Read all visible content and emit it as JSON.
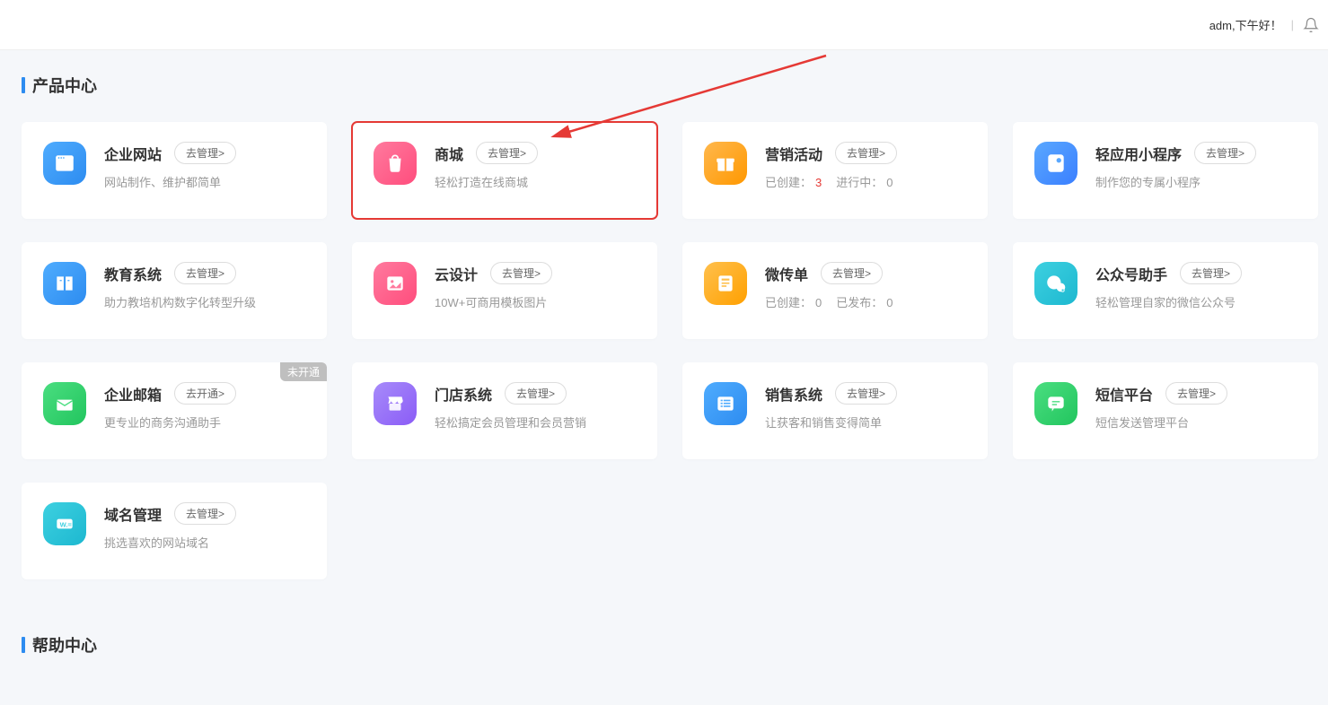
{
  "header": {
    "greeting": "adm,下午好！",
    "separator": "|"
  },
  "section1": {
    "title": "产品中心"
  },
  "section2": {
    "title": "帮助中心"
  },
  "cards": [
    {
      "title": "企业网站",
      "btn": "去管理>",
      "desc": "网站制作、维护都简单",
      "icon": "website-icon",
      "color": "bg-blue1"
    },
    {
      "title": "商城",
      "btn": "去管理>",
      "desc": "轻松打造在线商城",
      "icon": "shop-icon",
      "color": "bg-pink",
      "highlight": true
    },
    {
      "title": "营销活动",
      "btn": "去管理>",
      "stats": {
        "label1": "已创建：",
        "val1": "3",
        "label2": "进行中：",
        "val2": "0"
      },
      "icon": "gift-icon",
      "color": "bg-orange",
      "val1_red": true
    },
    {
      "title": "轻应用小程序",
      "btn": "去管理>",
      "desc": "制作您的专属小程序",
      "icon": "miniapp-icon",
      "color": "bg-blue2"
    },
    {
      "title": "教育系统",
      "btn": "去管理>",
      "desc": "助力教培机构数字化转型升级",
      "icon": "book-icon",
      "color": "bg-blue1"
    },
    {
      "title": "云设计",
      "btn": "去管理>",
      "desc": "10W+可商用模板图片",
      "icon": "image-icon",
      "color": "bg-pink"
    },
    {
      "title": "微传单",
      "btn": "去管理>",
      "stats": {
        "label1": "已创建：",
        "val1": "0",
        "label2": "已发布：",
        "val2": "0"
      },
      "icon": "flyer-icon",
      "color": "bg-orange2"
    },
    {
      "title": "公众号助手",
      "btn": "去管理>",
      "desc": "轻松管理自家的微信公众号",
      "icon": "wechat-icon",
      "color": "bg-cyan"
    },
    {
      "title": "企业邮箱",
      "btn": "去开通>",
      "desc": "更专业的商务沟通助手",
      "icon": "mail-icon",
      "color": "bg-green",
      "badge": "未开通"
    },
    {
      "title": "门店系统",
      "btn": "去管理>",
      "desc": "轻松搞定会员管理和会员营销",
      "icon": "store-icon",
      "color": "bg-purple"
    },
    {
      "title": "销售系统",
      "btn": "去管理>",
      "desc": "让获客和销售变得简单",
      "icon": "list-icon",
      "color": "bg-blue1"
    },
    {
      "title": "短信平台",
      "btn": "去管理>",
      "desc": "短信发送管理平台",
      "icon": "sms-icon",
      "color": "bg-green"
    },
    {
      "title": "域名管理",
      "btn": "去管理>",
      "desc": "挑选喜欢的网站域名",
      "icon": "domain-icon",
      "color": "bg-cyan"
    }
  ]
}
